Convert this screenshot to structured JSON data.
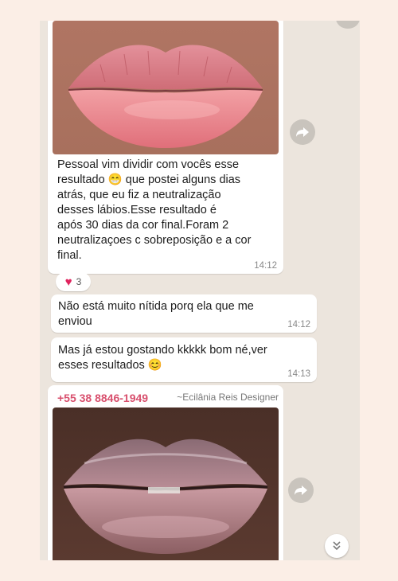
{
  "messages": [
    {
      "text": "Pessoal vim dividir com vocês esse\nresultado 😁 que postei alguns dias\natrás, que eu fiz a neutralização\ndesses lábios.Esse resultado é\napós 30 dias da cor final.Foram 2\nneutralizaçoes c sobreposição e a cor\nfinal.",
      "time": "14:12",
      "reaction": {
        "emoji": "❤️",
        "count": "3"
      }
    },
    {
      "text": "Não está muito nítida porq ela que me\nenviou",
      "time": "14:12"
    },
    {
      "text": "Mas já estou gostando kkkkk bom né,ver\nesses resultados 😊",
      "time": "14:13"
    },
    {
      "sender_phone": "+55 38 8846-1949",
      "sender_name": "~Ecilânia Reis Designer"
    }
  ],
  "icons": {
    "forward": "forward-arrow-icon",
    "scroll_down": "double-chevron-down-icon"
  },
  "colors": {
    "chat_background": "#ece5dd",
    "bubble": "#ffffff",
    "sender_phone": "#d84f6d"
  }
}
